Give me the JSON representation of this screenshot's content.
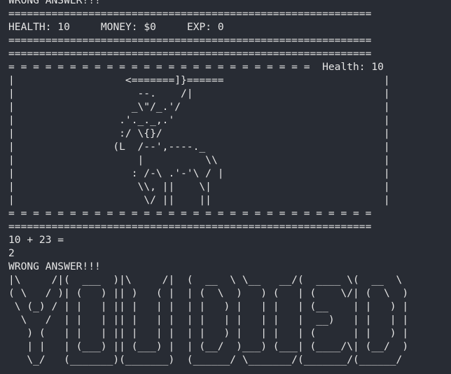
{
  "terminal": {
    "prev_message": "WRONG ANSWER!!!",
    "divider": "===========================================================",
    "status": {
      "health": "HEALTH: 10",
      "money": "MONEY: $0",
      "exp": "EXP: 0"
    },
    "divider2": "===========================================================",
    "divider3": "===========================================================",
    "scene_top_border": "= = = = = = = = = = = = = = = = = = = = = = = = =  Health: 10",
    "scene_art": "|                  <=======]}======                          |\n|                    --.    /|                               |\n|                   _\\\"/_.'/                                 |\n|                 .'._._,.'                                  |\n|                 :/ \\{}/                                    |\n|                (L  /--',----._                             |\n|                    |          \\\\                           |\n|                   : /-\\ .'-'\\ / |                          |\n|                    \\\\, ||    \\|                            |\n|                     \\/ ||    ||                            |",
    "scene_bottom_border": "= = = = = = = = = = = = = = = = = = = = = = = = = = = = = =",
    "divider4": "===========================================================",
    "question": "10 + 23 =",
    "user_input": "2",
    "result_message": "WRONG ANSWER!!!",
    "you_died_art": "|\\     /|(  ___  )|\\     /|  (  __  \\ \\__   __/(  ____ \\(  __  \\\n( \\   / )| (   ) || )   ( |  | (  \\  )   ) (   | (    \\/| (  \\  )\n \\ (_) / | |   | || |   | |  | |   ) |   | |   | (__    | |   ) |\n  \\   /  | |   | || |   | |  | |   | |   | |   |  __)   | |   | |\n   ) (   | |   | || |   | |  | |   ) |   | |   | (      | |   ) |\n   | |   | (___) || (___) |  | (__/  )___) (___| (____/\\| (__/  )\n   \\_/   (_______)(_______)  (______/ \\_______/(_______/(______/"
  }
}
